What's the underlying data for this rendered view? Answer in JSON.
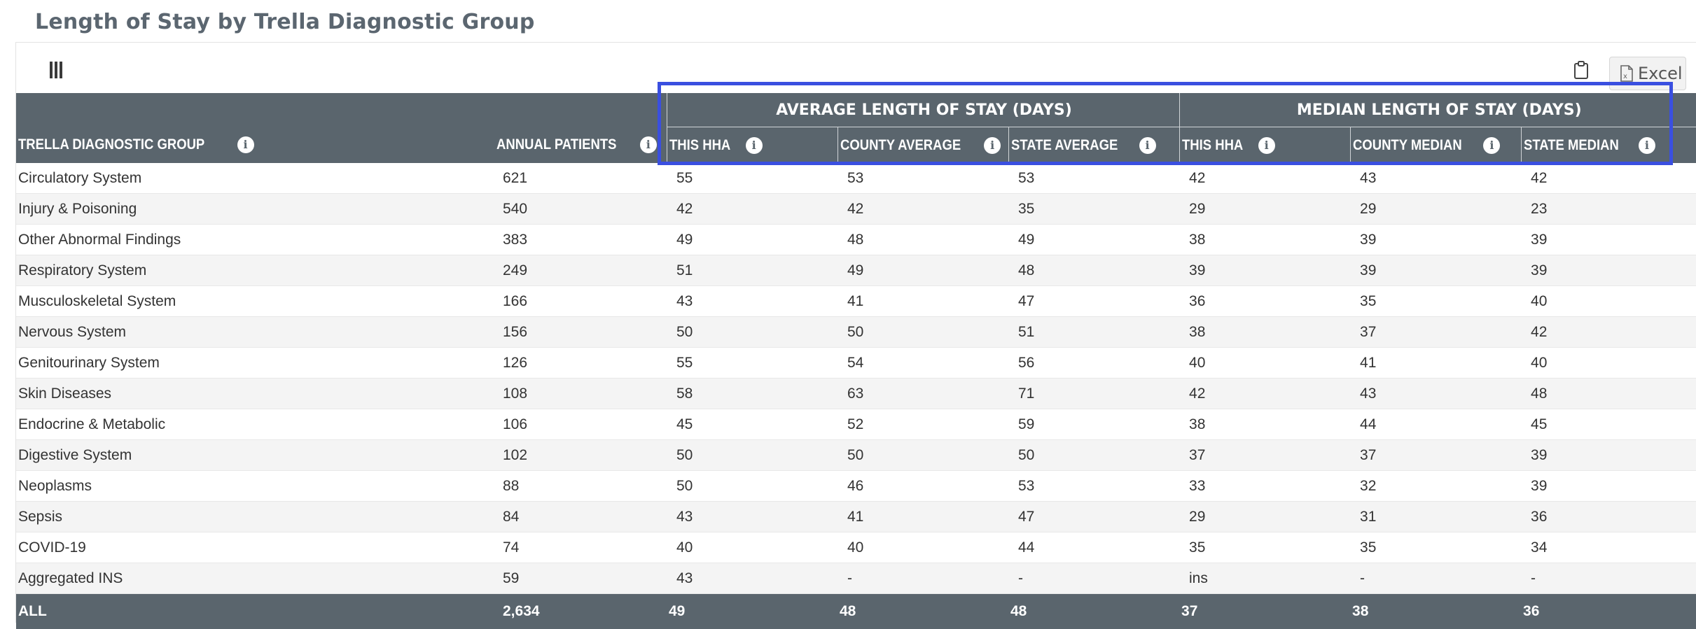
{
  "page": {
    "title": "Length of Stay by Trella Diagnostic Group"
  },
  "toolbar": {
    "excel_label": "Excel"
  },
  "table": {
    "groups": {
      "average": "AVERAGE LENGTH OF STAY (DAYS)",
      "median": "MEDIAN LENGTH OF STAY (DAYS)"
    },
    "columns": [
      "TRELLA DIAGNOSTIC GROUP",
      "ANNUAL PATIENTS",
      "THIS HHA",
      "COUNTY AVERAGE",
      "STATE AVERAGE",
      "THIS HHA",
      "COUNTY MEDIAN",
      "STATE MEDIAN"
    ],
    "rows": [
      [
        "Circulatory System",
        "621",
        "55",
        "53",
        "53",
        "42",
        "43",
        "42"
      ],
      [
        "Injury & Poisoning",
        "540",
        "42",
        "42",
        "35",
        "29",
        "29",
        "23"
      ],
      [
        "Other Abnormal Findings",
        "383",
        "49",
        "48",
        "49",
        "38",
        "39",
        "39"
      ],
      [
        "Respiratory System",
        "249",
        "51",
        "49",
        "48",
        "39",
        "39",
        "39"
      ],
      [
        "Musculoskeletal System",
        "166",
        "43",
        "41",
        "47",
        "36",
        "35",
        "40"
      ],
      [
        "Nervous System",
        "156",
        "50",
        "50",
        "51",
        "38",
        "37",
        "42"
      ],
      [
        "Genitourinary System",
        "126",
        "55",
        "54",
        "56",
        "40",
        "41",
        "40"
      ],
      [
        "Skin Diseases",
        "108",
        "58",
        "63",
        "71",
        "42",
        "43",
        "48"
      ],
      [
        "Endocrine & Metabolic",
        "106",
        "45",
        "52",
        "59",
        "38",
        "44",
        "45"
      ],
      [
        "Digestive System",
        "102",
        "50",
        "50",
        "50",
        "37",
        "37",
        "39"
      ],
      [
        "Neoplasms",
        "88",
        "50",
        "46",
        "53",
        "33",
        "32",
        "39"
      ],
      [
        "Sepsis",
        "84",
        "43",
        "41",
        "47",
        "29",
        "31",
        "36"
      ],
      [
        "COVID-19",
        "74",
        "40",
        "40",
        "44",
        "35",
        "35",
        "34"
      ],
      [
        "Aggregated INS",
        "59",
        "43",
        "-",
        "-",
        "ins",
        "-",
        "-"
      ]
    ],
    "total": [
      "ALL",
      "2,634",
      "49",
      "48",
      "48",
      "37",
      "38",
      "36"
    ]
  },
  "colors": {
    "header_bg": "#5a656d",
    "highlight": "#3a4fe0",
    "title": "#5b6670"
  }
}
